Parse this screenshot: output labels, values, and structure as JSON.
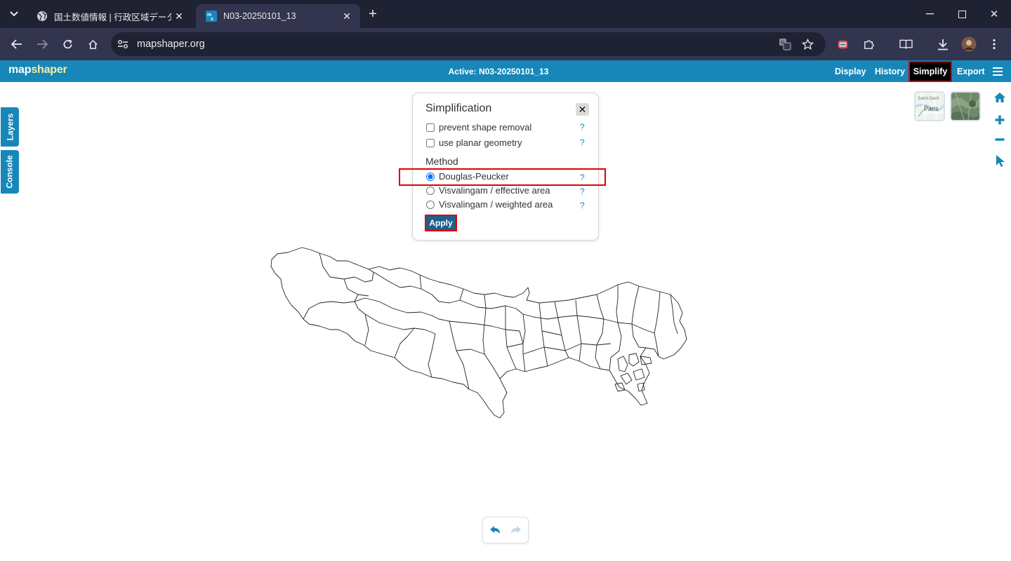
{
  "browser": {
    "tabs": [
      {
        "title": "国土数値情報 | 行政区域データ",
        "active": false
      },
      {
        "title": "N03-20250101_13",
        "active": true
      }
    ],
    "url": "mapshaper.org"
  },
  "app": {
    "logo_map": "map",
    "logo_shaper": "shaper",
    "active_label": "Active: N03-20250101_13",
    "nav": {
      "display": "Display",
      "history": "History",
      "simplify": "Simplify",
      "export": "Export"
    },
    "side_tabs": {
      "layers": "Layers",
      "console": "Console"
    },
    "basemaps": {
      "city_top": "Saint-Deni",
      "city_main": "Paris"
    }
  },
  "panel": {
    "title": "Simplification",
    "options": {
      "prevent_shape_removal": "prevent shape removal",
      "use_planar_geometry": "use planar geometry"
    },
    "method_label": "Method",
    "methods": {
      "douglas": "Douglas-Peucker",
      "visvalingam_effective": "Visvalingam / effective area",
      "visvalingam_weighted": "Visvalingam / weighted area"
    },
    "selected_method": "Douglas-Peucker",
    "help": "?",
    "apply": "Apply"
  },
  "colors": {
    "accent": "#1787ba",
    "highlight": "#e00000",
    "chrome_dark": "#1f2232",
    "chrome_mid": "#32354d"
  }
}
